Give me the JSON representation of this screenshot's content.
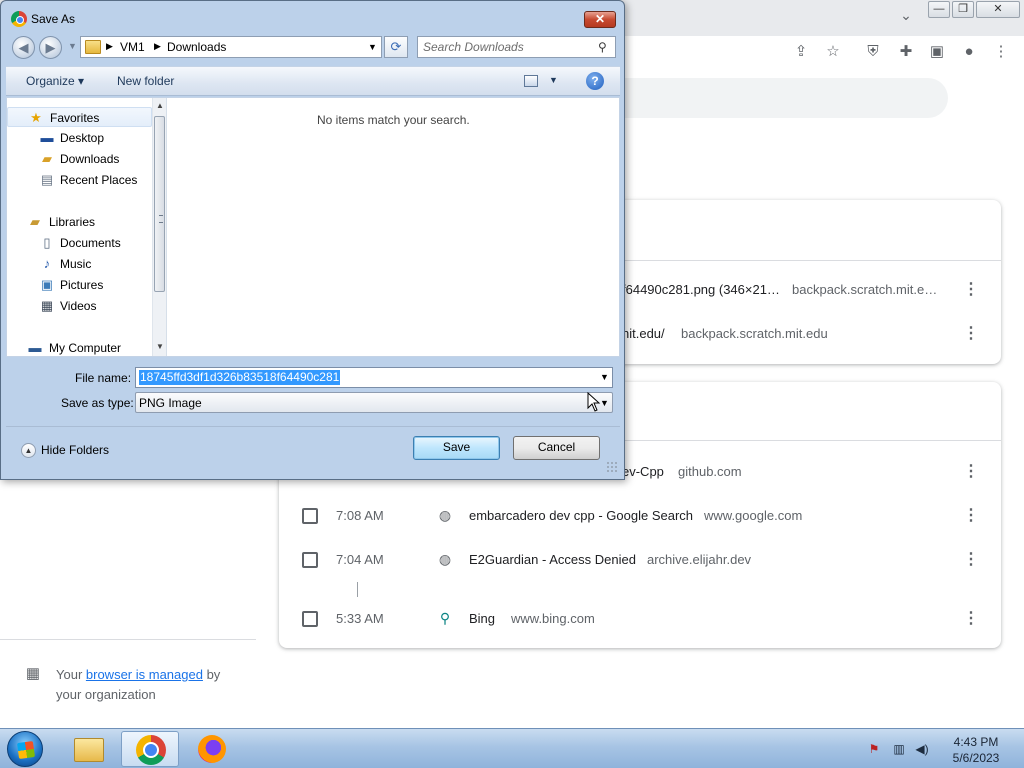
{
  "chrome": {
    "window_controls": [
      "⌄",
      "—",
      "❐",
      "✕"
    ],
    "toolbar_icons": [
      "share-icon",
      "bookmark-star-icon",
      "shield-extension-icon",
      "puzzle-extensions-icon",
      "side-panel-icon",
      "profile-avatar-icon",
      "menu-kebab-icon"
    ],
    "history_rows": [
      {
        "title": "f64490c281.png (346×21…",
        "domain": "backpack.scratch.mit.e…"
      },
      {
        "title": "nit.edu/",
        "domain": "backpack.scratch.mit.edu"
      },
      {
        "title": "ev-Cpp",
        "domain": "github.com"
      },
      {
        "time": "7:08 AM",
        "title": "embarcadero dev cpp - Google Search",
        "domain": "www.google.com",
        "favicon": "globe-icon"
      },
      {
        "time": "7:04 AM",
        "title": "E2Guardian - Access Denied",
        "domain": "archive.elijahr.dev",
        "favicon": "globe-icon"
      },
      {
        "time": "5:33 AM",
        "title": "Bing",
        "domain": "www.bing.com",
        "favicon": "search-icon"
      }
    ],
    "managed": {
      "prefix": "Your ",
      "link": "browser is managed",
      "suffix": " by your organization"
    }
  },
  "dialog": {
    "title": "Save As",
    "breadcrumb": [
      "VM1",
      "Downloads"
    ],
    "search_placeholder": "Search Downloads",
    "commands": {
      "organize": "Organize ▾",
      "new_folder": "New folder"
    },
    "nav_items": [
      {
        "label": "Favorites",
        "icon": "star-icon"
      },
      {
        "label": "Desktop",
        "icon": "desktop-icon"
      },
      {
        "label": "Downloads",
        "icon": "downloads-folder-icon"
      },
      {
        "label": "Recent Places",
        "icon": "recent-places-icon"
      },
      {
        "label": "Libraries",
        "icon": "libraries-icon"
      },
      {
        "label": "Documents",
        "icon": "documents-icon"
      },
      {
        "label": "Music",
        "icon": "music-icon"
      },
      {
        "label": "Pictures",
        "icon": "pictures-icon"
      },
      {
        "label": "Videos",
        "icon": "videos-icon"
      },
      {
        "label": "My Computer",
        "icon": "computer-icon"
      }
    ],
    "empty_message": "No items match your search.",
    "file_name_label": "File name:",
    "file_name_value": "18745ffd3df1d326b83518f64490c281",
    "save_type_label": "Save as type:",
    "save_type_value": "PNG Image",
    "hide_folders": "Hide Folders",
    "save_button": "Save",
    "cancel_button": "Cancel"
  },
  "taskbar": {
    "apps": [
      "windows-explorer",
      "google-chrome",
      "firefox"
    ],
    "clock_time": "4:43 PM",
    "clock_date": "5/6/2023"
  }
}
